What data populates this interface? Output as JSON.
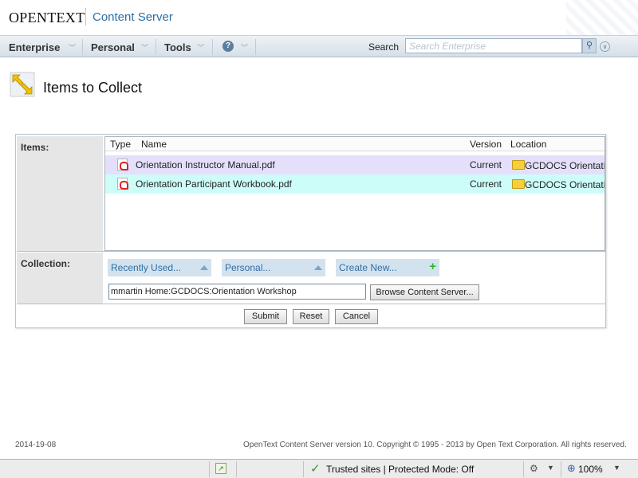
{
  "header": {
    "logo_text": "OPENTEXT",
    "product_name": "Content Server"
  },
  "navbar": {
    "items": [
      {
        "label": "Enterprise",
        "icon": "chevron-down-icon"
      },
      {
        "label": "Personal",
        "icon": "chevron-down-icon"
      },
      {
        "label": "Tools",
        "icon": "chevron-down-icon"
      }
    ],
    "help_icon": "help-icon",
    "search_label": "Search",
    "search_placeholder": "Search Enterprise"
  },
  "page": {
    "title": "Items to Collect",
    "icon": "collect-arrows-icon"
  },
  "items_section": {
    "label": "Items:",
    "columns": [
      "Type",
      "Name",
      "Version",
      "Location"
    ],
    "rows": [
      {
        "type_icon": "pdf-icon",
        "name": "Orientation Instructor Manual.pdf",
        "version": "Current",
        "location": "GCDOCS Orientation"
      },
      {
        "type_icon": "pdf-icon",
        "name": "Orientation Participant Workbook.pdf",
        "version": "Current",
        "location": "GCDOCS Orientation"
      }
    ]
  },
  "collection_section": {
    "label": "Collection:",
    "recently_used": "Recently Used...",
    "personal": "Personal...",
    "create_new": "Create New...",
    "path_value": "mmartin Home:GCDOCS:Orientation Workshop",
    "browse_label": "Browse Content Server..."
  },
  "buttons": {
    "submit": "Submit",
    "reset": "Reset",
    "cancel": "Cancel"
  },
  "footer": {
    "date": "2014-19-08",
    "copyright": "OpenText Content Server version 10. Copyright © 1995 - 2013 by Open Text Corporation. All rights reserved."
  },
  "statusbar": {
    "zone": "Trusted sites | Protected Mode: Off",
    "zoom": "100%"
  },
  "colors": {
    "accent": "#2f6ea3",
    "row_selected": "#e4e0fb",
    "row_highlight": "#ccfdf8"
  }
}
